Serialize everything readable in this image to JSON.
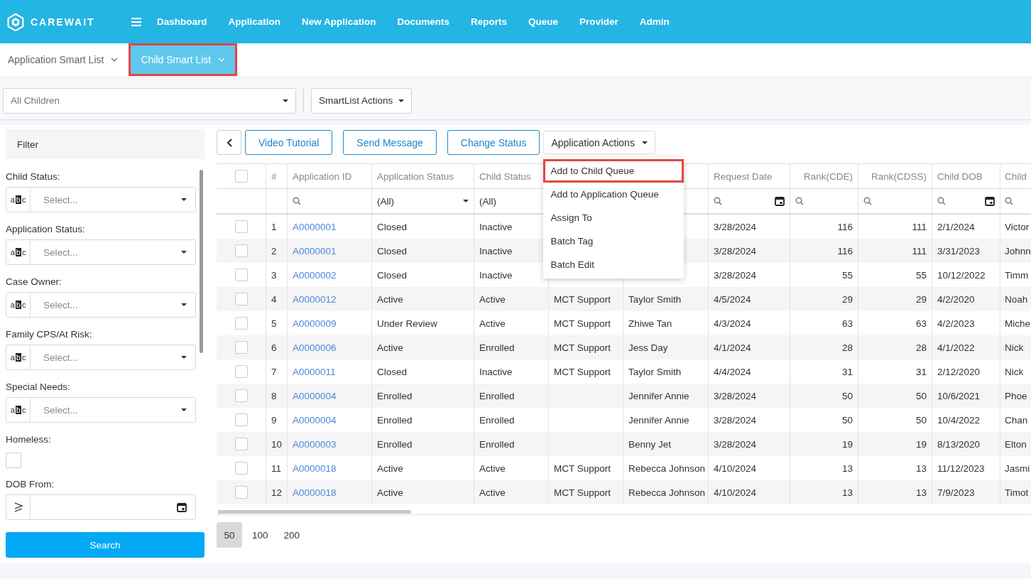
{
  "brand": {
    "name": "CAREWAIT"
  },
  "nav": [
    {
      "label": "Dashboard"
    },
    {
      "label": "Application"
    },
    {
      "label": "New Application"
    },
    {
      "label": "Documents"
    },
    {
      "label": "Reports"
    },
    {
      "label": "Queue"
    },
    {
      "label": "Provider"
    },
    {
      "label": "Admin"
    }
  ],
  "smart_tabs": [
    {
      "label": "Application Smart List",
      "selected": false
    },
    {
      "label": "Child Smart List",
      "selected": true
    }
  ],
  "toolbar": {
    "list_select": "All Children",
    "actions": "SmartList Actions"
  },
  "filter": {
    "title": "Filter",
    "fields": [
      {
        "kind": "select",
        "label": "Child Status:",
        "operator": "abc",
        "placeholder": "Select..."
      },
      {
        "kind": "select",
        "label": "Application Status:",
        "operator": "abc",
        "placeholder": "Select..."
      },
      {
        "kind": "select",
        "label": "Case Owner:",
        "operator": "abc",
        "placeholder": "Select..."
      },
      {
        "kind": "select",
        "label": "Family CPS/At Risk:",
        "operator": "abc",
        "placeholder": "Select..."
      },
      {
        "kind": "select",
        "label": "Special Needs:",
        "operator": "abc",
        "placeholder": "Select..."
      },
      {
        "kind": "checkbox",
        "label": "Homeless:",
        "checked": false
      },
      {
        "kind": "date",
        "label": "DOB From:"
      }
    ],
    "search_button": "Search"
  },
  "actions": {
    "buttons": [
      "Video Tutorial",
      "Send Message",
      "Change Status"
    ],
    "menu_button": "Application Actions",
    "menu": [
      {
        "label": "Add to Child Queue",
        "selected": true
      },
      {
        "label": "Add to Application Queue",
        "selected": false
      },
      {
        "label": "Assign To",
        "selected": false
      },
      {
        "label": "Batch Tag",
        "selected": false
      },
      {
        "label": "Batch Edit",
        "selected": false
      }
    ]
  },
  "table": {
    "select_all": {
      "checked": false
    },
    "columns": [
      {
        "kind": "check",
        "filter": {
          "kind": "none"
        }
      },
      {
        "kind": "index",
        "label": "#",
        "filter": {
          "kind": "none"
        }
      },
      {
        "kind": "link",
        "label": "Application ID",
        "filter": {
          "kind": "search"
        }
      },
      {
        "kind": "text",
        "label": "Application Status",
        "filter": {
          "kind": "dropdown",
          "value": "(All)"
        }
      },
      {
        "kind": "text",
        "label": "Child Status",
        "filter": {
          "kind": "text",
          "value": "(All)"
        }
      },
      {
        "kind": "text",
        "filter": {
          "kind": "none"
        }
      },
      {
        "kind": "text",
        "filter": {
          "kind": "none"
        }
      },
      {
        "kind": "text",
        "label": "Request Date",
        "filter": {
          "kind": "date"
        }
      },
      {
        "kind": "number",
        "label": "Rank(CDE)",
        "filter": {
          "kind": "search"
        }
      },
      {
        "kind": "number",
        "label": "Rank(CDSS)",
        "filter": {
          "kind": "search"
        }
      },
      {
        "kind": "text",
        "label": "Child DOB",
        "filter": {
          "kind": "date"
        }
      },
      {
        "kind": "text",
        "label": "Child",
        "filter": {
          "kind": "search"
        }
      }
    ],
    "rows": [
      {
        "checked": false,
        "cells": [
          "",
          "1",
          "A0000001",
          "Closed",
          "Inactive",
          "",
          "",
          "3/28/2024",
          "116",
          "111",
          "2/1/2024",
          "Victor"
        ]
      },
      {
        "checked": false,
        "cells": [
          "",
          "2",
          "A0000001",
          "Closed",
          "Inactive",
          "",
          "",
          "3/28/2024",
          "116",
          "111",
          "3/31/2023",
          "Johnn"
        ]
      },
      {
        "checked": false,
        "cells": [
          "",
          "3",
          "A0000002",
          "Closed",
          "Inactive",
          "",
          "",
          "3/28/2024",
          "55",
          "55",
          "10/12/2022",
          "Timm"
        ]
      },
      {
        "checked": false,
        "cells": [
          "",
          "4",
          "A0000012",
          "Active",
          "Active",
          "MCT Support",
          "Taylor Smith",
          "4/5/2024",
          "29",
          "29",
          "4/2/2020",
          "Noah"
        ]
      },
      {
        "checked": false,
        "cells": [
          "",
          "5",
          "A0000009",
          "Under Review",
          "Active",
          "MCT Support",
          "Zhiwe Tan",
          "4/3/2024",
          "63",
          "63",
          "4/2/2023",
          "Miche"
        ]
      },
      {
        "checked": false,
        "cells": [
          "",
          "6",
          "A0000006",
          "Active",
          "Enrolled",
          "MCT Support",
          "Jess Day",
          "4/1/2024",
          "28",
          "28",
          "4/1/2022",
          "Nick"
        ]
      },
      {
        "checked": false,
        "cells": [
          "",
          "7",
          "A0000011",
          "Closed",
          "Inactive",
          "MCT Support",
          "Taylor Smith",
          "4/4/2024",
          "31",
          "31",
          "2/12/2020",
          "Nick"
        ]
      },
      {
        "checked": false,
        "cells": [
          "",
          "8",
          "A0000004",
          "Enrolled",
          "Enrolled",
          "",
          "Jennifer Annie",
          "3/28/2024",
          "50",
          "50",
          "10/6/2021",
          "Phoe"
        ]
      },
      {
        "checked": false,
        "cells": [
          "",
          "9",
          "A0000004",
          "Enrolled",
          "Enrolled",
          "",
          "Jennifer Annie",
          "3/28/2024",
          "50",
          "50",
          "10/4/2022",
          "Chan"
        ]
      },
      {
        "checked": false,
        "cells": [
          "",
          "10",
          "A0000003",
          "Enrolled",
          "Enrolled",
          "",
          "Benny Jet",
          "3/28/2024",
          "19",
          "19",
          "8/13/2020",
          "Elton"
        ]
      },
      {
        "checked": false,
        "cells": [
          "",
          "11",
          "A0000018",
          "Active",
          "Active",
          "MCT Support",
          "Rebecca Johnson",
          "4/10/2024",
          "13",
          "13",
          "11/12/2023",
          "Jasmi"
        ]
      },
      {
        "checked": false,
        "cells": [
          "",
          "12",
          "A0000018",
          "Active",
          "Active",
          "MCT Support",
          "Rebecca Johnson",
          "4/10/2024",
          "13",
          "13",
          "7/9/2023",
          "Timot"
        ]
      }
    ]
  },
  "pagination": [
    {
      "label": "50",
      "selected": true
    },
    {
      "label": "100",
      "selected": false
    },
    {
      "label": "200",
      "selected": false
    }
  ]
}
